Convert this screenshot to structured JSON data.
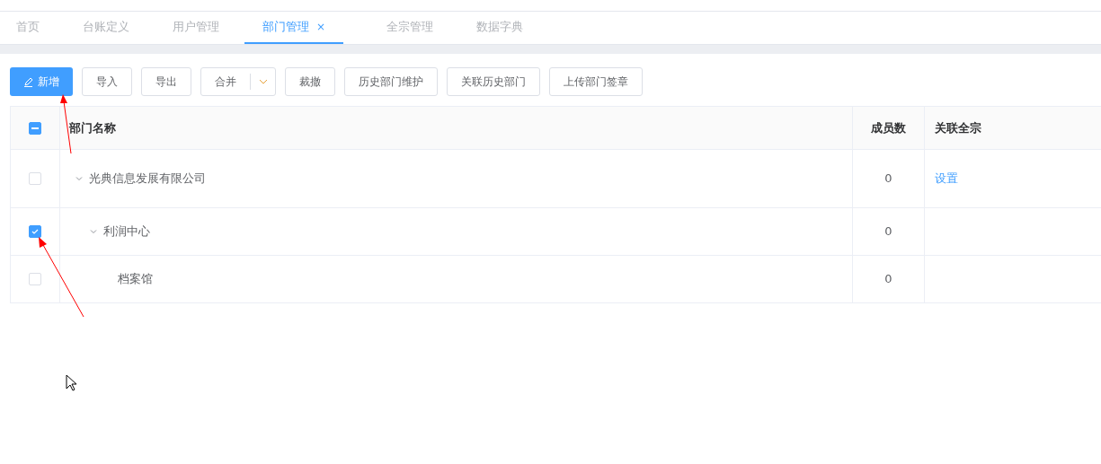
{
  "tabs": [
    {
      "label": "首页",
      "selected": false
    },
    {
      "label": "台账定义",
      "selected": false
    },
    {
      "label": "用户管理",
      "selected": false
    },
    {
      "label": "部门管理",
      "selected": true,
      "close": "×"
    },
    {
      "label": "全宗管理",
      "selected": false
    },
    {
      "label": "数据字典",
      "selected": false
    }
  ],
  "toolbar": [
    {
      "kind": "primary",
      "label": "新增"
    },
    {
      "kind": "plain",
      "label": "导入"
    },
    {
      "kind": "plain",
      "label": "导出"
    },
    {
      "kind": "split",
      "label": "合并"
    },
    {
      "kind": "plain",
      "label": "裁撤"
    },
    {
      "kind": "plain",
      "label": "历史部门维护"
    },
    {
      "kind": "plain",
      "label": "关联历史部门"
    },
    {
      "kind": "plain",
      "label": "上传部门签章"
    }
  ],
  "table": {
    "header_checkbox": {
      "indeterminate": true
    },
    "columns": [
      "部门名称",
      "成员数",
      "关联全宗"
    ],
    "rows": [
      {
        "name": "光典信息发展有限公司",
        "members": "0",
        "link": "设置",
        "checked": false,
        "expanded": true,
        "children": [
          {
            "name": "利润中心",
            "members": "0",
            "checked": true,
            "expanded": true,
            "children": [
              {
                "name": "档案馆",
                "members": "0",
                "checked": false
              }
            ]
          }
        ]
      }
    ]
  }
}
